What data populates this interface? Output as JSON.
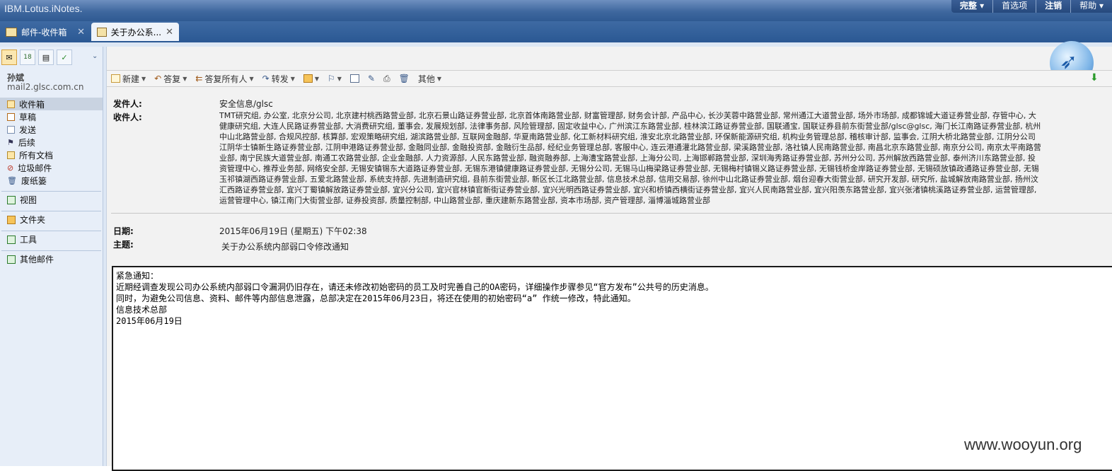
{
  "app": {
    "brand": "IBM.Lotus.iNotes."
  },
  "topmenu": {
    "items": [
      "完整",
      "首选项",
      "注销",
      "帮助"
    ]
  },
  "tabs": [
    {
      "label": "邮件-收件箱",
      "close": "✕"
    },
    {
      "label": "关于办公系...",
      "close": "✕"
    }
  ],
  "sidebar": {
    "user_name": "孙斌",
    "user_host": "mail2.glsc.com.cn",
    "calendar_day": "18",
    "folders": [
      "收件箱",
      "草稿",
      "发送",
      "后续",
      "所有文档",
      "垃圾邮件",
      "废纸篓"
    ],
    "sections": [
      "视图",
      "文件夹",
      "工具",
      "其他邮件"
    ]
  },
  "toolbar": {
    "new": "新建",
    "reply": "答复",
    "reply_all": "答复所有人",
    "forward": "转发",
    "more": "其他"
  },
  "header": {
    "from_label": "发件人:",
    "from_value": "安全信息/glsc",
    "to_label": "收件人:",
    "to_value": "TMT研究组, 办公室, 北京分公司, 北京建村桃西路营业部, 北京石景山路证券营业部, 北京首体南路营业部, 财富管理部, 财务会计部, 产品中心, 长沙芙蓉中路营业部, 常州通江大道营业部, 场外市场部, 成都锦城大道证券营业部, 存管中心, 大\n健康研究组, 大连人民路证券营业部, 大消费研究组, 董事会, 发展规划部, 法律事务部, 风险管理部, 固定收益中心, 广州滨江东路营业部, 桂林滨江路证券营业部, 国联通宝, 国联证券县前东街营业部/glsc@glsc, 海门长江南路证券营业部, 杭州\n中山北路营业部, 合规风控部, 核算部, 宏观策略研究组, 湖滨路营业部, 互联网金融部, 华夏南路营业部, 化工新材料研究组, 淮安北京北路营业部, 环保新能源研究组, 机构业务管理总部, 稽核审计部, 监事会, 江阴大桥北路营业部, 江阴分公司\n江阴华士镇新生路证券营业部, 江阴申港路证券营业部, 金融同业部, 金融投资部, 金融衍生品部, 经纪业务管理总部, 客服中心, 连云港通灌北路营业部, 梁溪路营业部, 洛社镇人民南路营业部, 南昌北京东路营业部, 南京分公司, 南京太平南路营\n业部, 南宁民族大道营业部, 南通工农路营业部, 企业金融部, 人力资源部, 人民东路营业部, 融资融券部, 上海漕宝路营业部, 上海分公司, 上海邯郸路营业部, 深圳海秀路证券营业部, 苏州分公司, 苏州解放西路营业部, 泰州济川东路营业部, 投\n资管理中心, 推荐业务部, 网络安全部, 无锡安镇锡东大道路证券营业部, 无锡东港镇健康路证券营业部, 无锡分公司, 无锡马山梅梁路证券营业部, 无锡梅村镇锡义路证券营业部, 无锡钱桥金岸路证券营业部, 无锡硕放镇政通路证券营业部, 无锡\n玉祁镇湖西路证券营业部, 五爱北路营业部, 系统支持部, 先进制造研究组, 县前东街营业部, 新区长江北路营业部, 信息技术总部, 信用交易部, 徐州中山北路证券营业部, 烟台迎春大街营业部, 研究开发部, 研究所, 盐城解放南路营业部, 扬州汶\n汇西路证券营业部, 宜兴丁蜀镇解放路证券营业部, 宜兴分公司, 宜兴官林镇官新街证券营业部, 宜兴光明西路证券营业部, 宜兴和桥镇西横街证券营业部, 宜兴人民南路营业部, 宜兴阳羡东路营业部, 宜兴张渚镇桃溪路证券营业部, 运营管理部,\n运营管理中心, 镇江南门大街营业部, 证券投资部, 质量控制部, 中山路营业部, 重庆建新东路营业部, 资本市场部, 资产管理部, 淄博淄城路营业部",
    "date_label": "日期:",
    "date_value": "2015年06月19日 (星期五) 下午02:38",
    "subject_label": "主题:",
    "subject_value": "关于办公系统内部弱口令修改通知"
  },
  "body": {
    "text": "紧急通知：\n近期经调查发现公司办公系统内部弱口令漏洞仍旧存在，请还未修改初始密码的员工及时完善自己的OA密码，详细操作步骤参见“官方发布”公共号的历史消息。\n同时，为避免公司信息、资料、邮件等内部信息泄露，总部决定在2015年06月23日，将还在使用的初始密码“a” 作统一修改，特此通知。\n信息技术总部\n2015年06月19日"
  },
  "watermark": "www.wooyun.org"
}
